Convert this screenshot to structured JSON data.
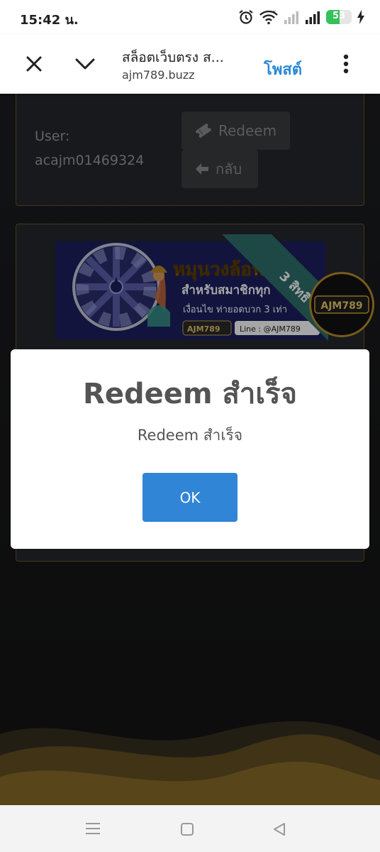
{
  "status_bar": {
    "time": "15:42 น.",
    "battery_level": 53,
    "battery_label": "53"
  },
  "toolbar": {
    "title": "สล็อตเว็บตรง ส...",
    "url": "ajm789.buzz",
    "post_label": "โพสต์"
  },
  "account": {
    "user_label": "User:",
    "username": "acajm01469324",
    "redeem_label": "Redeem",
    "back_label": "กลับ"
  },
  "banner": {
    "headline": "หมุนวงล้อฟรี",
    "subline": "สำหรับสมาชิกทุก",
    "condition": "เงื่อนไข ท่ายอดบวก 3 เท่า",
    "ribbon": "3 สิทธิ",
    "brand": "AJM789",
    "line_id": "Line : @AJM789"
  },
  "dialog": {
    "title": "Redeem สำเร็จ",
    "message": "Redeem สำเร็จ",
    "ok_label": "OK"
  },
  "colors": {
    "accent_blue": "#3085d6",
    "link_blue": "#2d8ad6",
    "gold": "#b98c2a",
    "battery_green": "#33c25b"
  }
}
